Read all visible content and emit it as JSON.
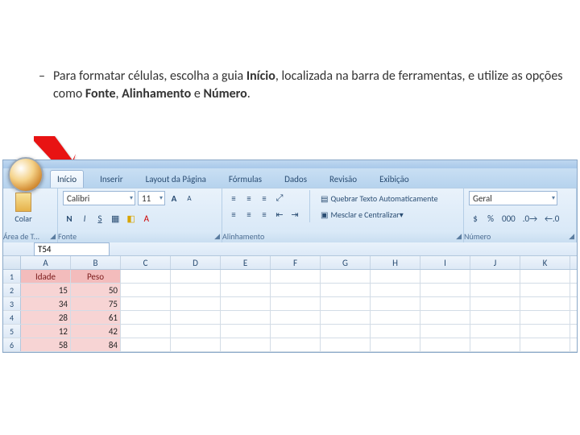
{
  "instruction": {
    "text_pre": "Para formatar células, escolha a guia ",
    "bold1": "Início",
    "text_mid1": ", localizada na barra de ferramentas, e utilize as opções como ",
    "bold2": "Fonte",
    "text_mid2": ", ",
    "bold3": "Alinhamento",
    "text_mid3": " e ",
    "bold4": "Número",
    "text_end": "."
  },
  "tabs": [
    "Início",
    "Inserir",
    "Layout da Página",
    "Fórmulas",
    "Dados",
    "Revisão",
    "Exibição"
  ],
  "ribbon": {
    "clipboard": {
      "label": "Área de T...",
      "paste": "Colar"
    },
    "font": {
      "label": "Fonte",
      "name": "Calibri",
      "size": "11"
    },
    "align": {
      "label": "Alinhamento",
      "wrap": "Quebrar Texto Automaticamente",
      "merge": "Mesclar e Centralizar"
    },
    "number": {
      "label": "Número",
      "format": "Geral"
    }
  },
  "namebox": "T54",
  "columns": [
    "A",
    "B",
    "C",
    "D",
    "E",
    "F",
    "G",
    "H",
    "I",
    "J",
    "K"
  ],
  "rows": [
    "1",
    "2",
    "3",
    "4",
    "5",
    "6"
  ],
  "headers": [
    "Idade",
    "Peso"
  ],
  "chart_data": {
    "type": "table",
    "columns": [
      "Idade",
      "Peso"
    ],
    "data": [
      [
        15,
        50
      ],
      [
        34,
        75
      ],
      [
        28,
        61
      ],
      [
        12,
        42
      ],
      [
        58,
        84
      ]
    ]
  }
}
